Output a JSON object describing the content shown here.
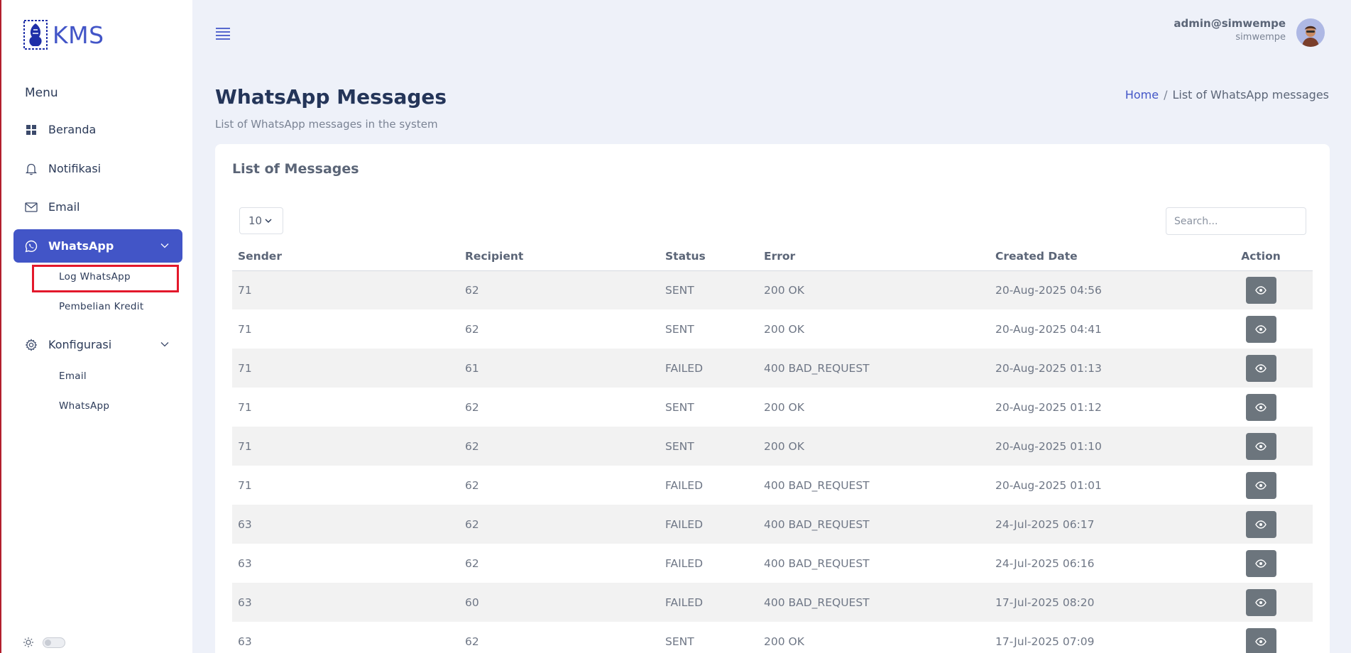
{
  "app": {
    "name": "KMS"
  },
  "sidebar": {
    "menu_heading": "Menu",
    "items": [
      {
        "label": "Beranda",
        "icon": "grid-icon"
      },
      {
        "label": "Notifikasi",
        "icon": "bell-icon"
      },
      {
        "label": "Email",
        "icon": "envelope-icon"
      },
      {
        "label": "WhatsApp",
        "icon": "whatsapp-icon",
        "active": true,
        "children": [
          {
            "label": "Log WhatsApp",
            "highlighted": true
          },
          {
            "label": "Pembelian Kredit"
          }
        ]
      },
      {
        "label": "Konfigurasi",
        "icon": "gear-icon",
        "children": [
          {
            "label": "Email"
          },
          {
            "label": "WhatsApp"
          }
        ]
      }
    ]
  },
  "header": {
    "user_name": "admin@simwempe",
    "user_sub": "simwempe"
  },
  "page": {
    "title": "WhatsApp Messages",
    "subtitle": "List of WhatsApp messages in the system",
    "breadcrumb": {
      "home": "Home",
      "current": "List of WhatsApp messages"
    }
  },
  "card": {
    "title": "List of Messages",
    "page_length": "10",
    "search_placeholder": "Search..."
  },
  "table": {
    "columns": [
      "Sender",
      "Recipient",
      "Status",
      "Error",
      "Created Date",
      "Action"
    ],
    "rows": [
      {
        "sender": "71",
        "recipient": "62",
        "status": "SENT",
        "error": "200 OK",
        "created": "20-Aug-2025 04:56"
      },
      {
        "sender": "71",
        "recipient": "62",
        "status": "SENT",
        "error": "200 OK",
        "created": "20-Aug-2025 04:41"
      },
      {
        "sender": "71",
        "recipient": "61",
        "status": "FAILED",
        "error": "400 BAD_REQUEST",
        "created": "20-Aug-2025 01:13"
      },
      {
        "sender": "71",
        "recipient": "62",
        "status": "SENT",
        "error": "200 OK",
        "created": "20-Aug-2025 01:12"
      },
      {
        "sender": "71",
        "recipient": "62",
        "status": "SENT",
        "error": "200 OK",
        "created": "20-Aug-2025 01:10"
      },
      {
        "sender": "71",
        "recipient": "62",
        "status": "FAILED",
        "error": "400 BAD_REQUEST",
        "created": "20-Aug-2025 01:01"
      },
      {
        "sender": "63",
        "recipient": "62",
        "status": "FAILED",
        "error": "400 BAD_REQUEST",
        "created": "24-Jul-2025 06:17"
      },
      {
        "sender": "63",
        "recipient": "62",
        "status": "FAILED",
        "error": "400 BAD_REQUEST",
        "created": "24-Jul-2025 06:16"
      },
      {
        "sender": "63",
        "recipient": "60",
        "status": "FAILED",
        "error": "400 BAD_REQUEST",
        "created": "17-Jul-2025 08:20"
      },
      {
        "sender": "63",
        "recipient": "62",
        "status": "SENT",
        "error": "200 OK",
        "created": "17-Jul-2025 07:09"
      }
    ]
  },
  "colors": {
    "accent": "#4255c7",
    "sidebar_bg": "#ffffff",
    "page_bg": "#eef1f9",
    "title": "#243559",
    "view_button": "#6c757d",
    "highlight_box": "#e3182b",
    "row_stripe": "#f2f2f2"
  }
}
